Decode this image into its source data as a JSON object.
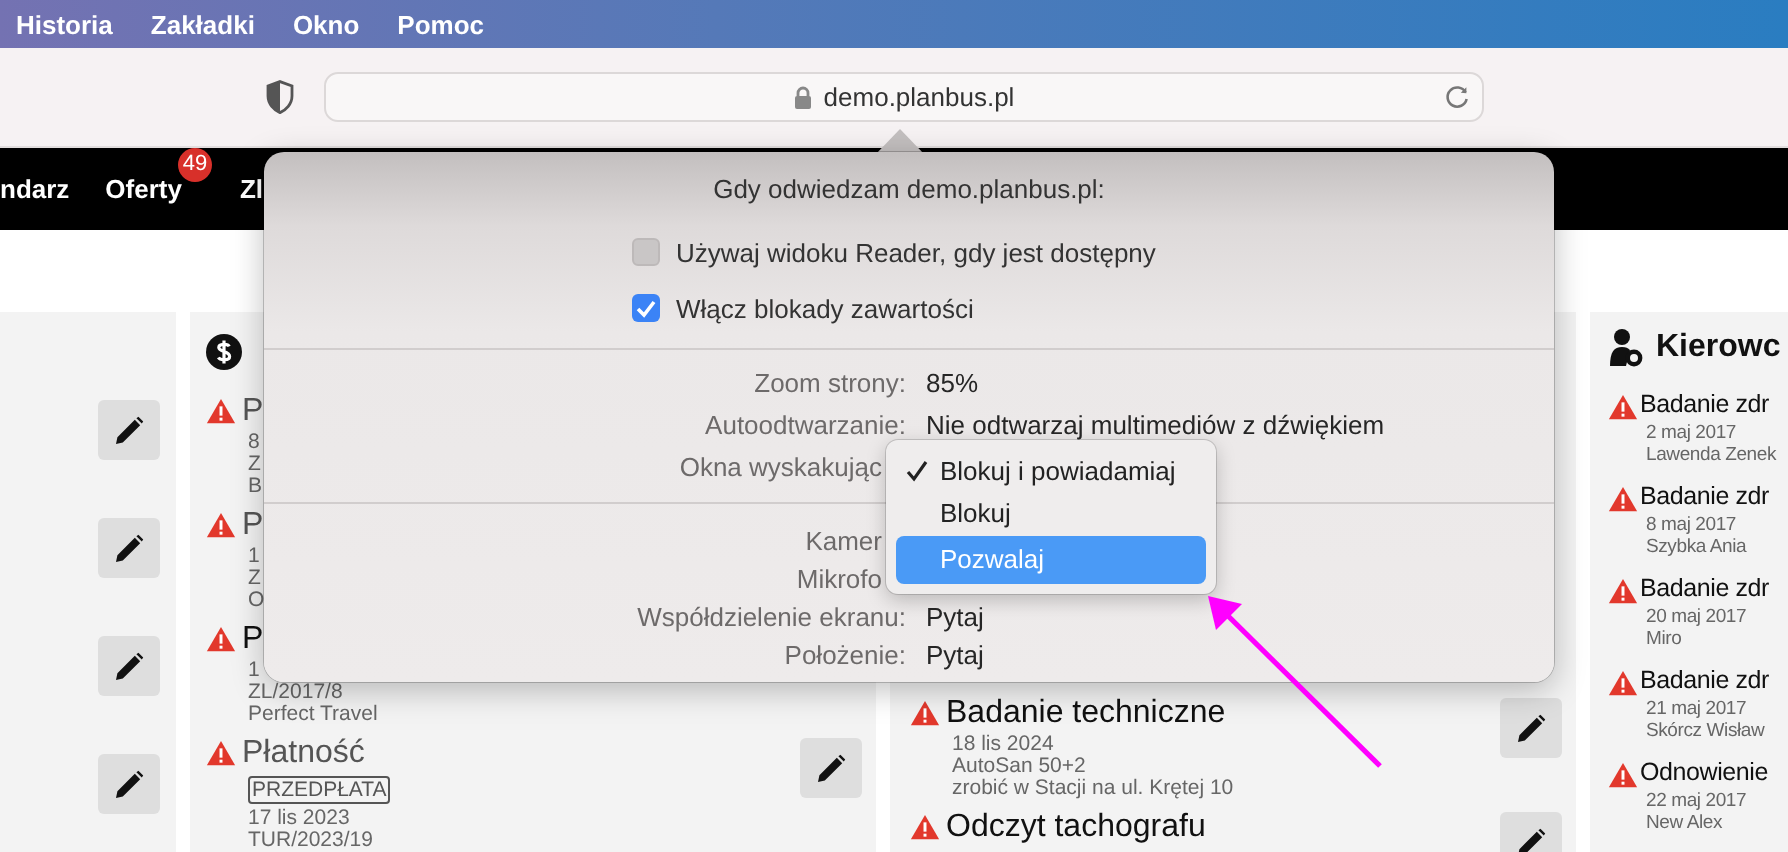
{
  "menubar": {
    "items": [
      "Historia",
      "Zakładki",
      "Okno",
      "Pomoc"
    ]
  },
  "toolbar": {
    "address": "demo.planbus.pl"
  },
  "site_nav": {
    "items": [
      {
        "label": "ndarz"
      },
      {
        "label": "Oferty",
        "badge": "49"
      },
      {
        "label": "Zl"
      }
    ]
  },
  "column_2": {
    "items": [
      {
        "title": "P",
        "emphasized": false,
        "lines": [
          "8",
          "Z",
          "B"
        ]
      },
      {
        "title": "P",
        "emphasized": false,
        "lines": [
          "1",
          "Z",
          "O"
        ]
      },
      {
        "title": "P",
        "emphasized": true,
        "lines": [
          "1",
          "ZL/2017/8",
          "Perfect Travel"
        ],
        "has_edit": false
      },
      {
        "title": "Płatność",
        "emphasized": false,
        "tag": "PRZEDPŁATA",
        "lines": [
          "17 lis 2023",
          "TUR/2023/19"
        ],
        "has_edit": true
      }
    ]
  },
  "column_3": {
    "items": [
      {
        "title": "Badanie techniczne",
        "lines": [
          "18 lis 2024",
          "AutoSan 50+2",
          "zrobić w Stacji na ul. Krętej 10"
        ],
        "has_edit": true
      },
      {
        "title": "Odczyt tachografu",
        "has_edit": true
      }
    ]
  },
  "column_4": {
    "title": "Kierowc",
    "items": [
      {
        "title": "Badanie zdr",
        "lines": [
          "2 maj 2017",
          "Lawenda Zenek"
        ]
      },
      {
        "title": "Badanie zdr",
        "lines": [
          "8 maj 2017",
          "Szybka Ania"
        ]
      },
      {
        "title": "Badanie zdr",
        "lines": [
          "20 maj 2017",
          "Miro"
        ]
      },
      {
        "title": "Badanie zdr",
        "lines": [
          "21 maj 2017",
          "Skórcz Wisław"
        ]
      },
      {
        "title": "Odnowienie",
        "lines": [
          "22 maj 2017",
          "New Alex"
        ]
      }
    ]
  },
  "popover": {
    "title": "Gdy odwiedzam demo.planbus.pl:",
    "options": [
      {
        "label": "Używaj widoku Reader, gdy jest dostępny",
        "checked": false
      },
      {
        "label": "Włącz blokady zawartości",
        "checked": true
      }
    ],
    "settings": [
      [
        {
          "label": "Zoom strony:",
          "value": "85%"
        },
        {
          "label": "Autoodtwarzanie:",
          "value": "Nie odtwarzaj multimediów z dźwiękiem"
        },
        {
          "label": "Okna wyskakując"
        }
      ],
      [
        {
          "label": "Kamer"
        },
        {
          "label": "Mikrofo"
        },
        {
          "label": "Współdzielenie ekranu:",
          "value": "Pytaj"
        },
        {
          "label": "Położenie:",
          "value": "Pytaj"
        }
      ]
    ],
    "menu": [
      {
        "label": "Blokuj i powiadamiaj",
        "checked": true,
        "selected": false
      },
      {
        "label": "Blokuj",
        "checked": false,
        "selected": false
      },
      {
        "label": "Pozwalaj",
        "checked": false,
        "selected": true
      }
    ]
  }
}
